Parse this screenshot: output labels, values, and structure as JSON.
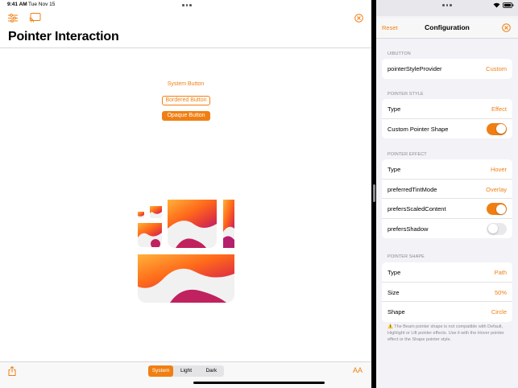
{
  "status_bar": {
    "time": "9:41 AM",
    "date": "Tue Nov 15"
  },
  "left_pane": {
    "title": "Pointer Interaction",
    "buttons": {
      "system": "System Button",
      "bordered": "Bordered Button",
      "opaque": "Opaque Button"
    },
    "appearance": {
      "options": [
        "System",
        "Light",
        "Dark"
      ],
      "selected": "System"
    },
    "text_size_label": "AA"
  },
  "config_panel": {
    "reset_label": "Reset",
    "title": "Configuration",
    "sections": {
      "uibutton": {
        "header": "UIBUTTON",
        "rows": [
          {
            "label": "pointerStyleProvider",
            "value": "Custom"
          }
        ]
      },
      "pointer_style": {
        "header": "POINTER STYLE",
        "type": {
          "label": "Type",
          "value": "Effect"
        },
        "custom_shape": {
          "label": "Custom Pointer Shape",
          "on": true
        }
      },
      "pointer_effect": {
        "header": "POINTER EFFECT",
        "type": {
          "label": "Type",
          "value": "Hover"
        },
        "tint_mode": {
          "label": "preferredTintMode",
          "value": "Overlay"
        },
        "scaled_content": {
          "label": "prefersScaledContent",
          "on": true
        },
        "shadow": {
          "label": "prefersShadow",
          "on": false
        }
      },
      "pointer_shape": {
        "header": "POINTER SHAPE",
        "type": {
          "label": "Type",
          "value": "Path"
        },
        "size": {
          "label": "Size",
          "value": "50%"
        },
        "shape": {
          "label": "Shape",
          "value": "Circle"
        }
      }
    },
    "footnote": "⚠️ The Beam pointer shape is not compatible with Default, Highlight or Lift pointer effects. Use it with the Hover pointer effect or the Shape pointer style."
  },
  "colors": {
    "accent": "#f07f13",
    "switch_off": "#e9e9eb",
    "panel_bg": "#f2f2f7"
  },
  "icons": [
    "sliders-icon",
    "cast-screen-icon",
    "close-circle-icon",
    "share-icon",
    "text-size-icon"
  ]
}
